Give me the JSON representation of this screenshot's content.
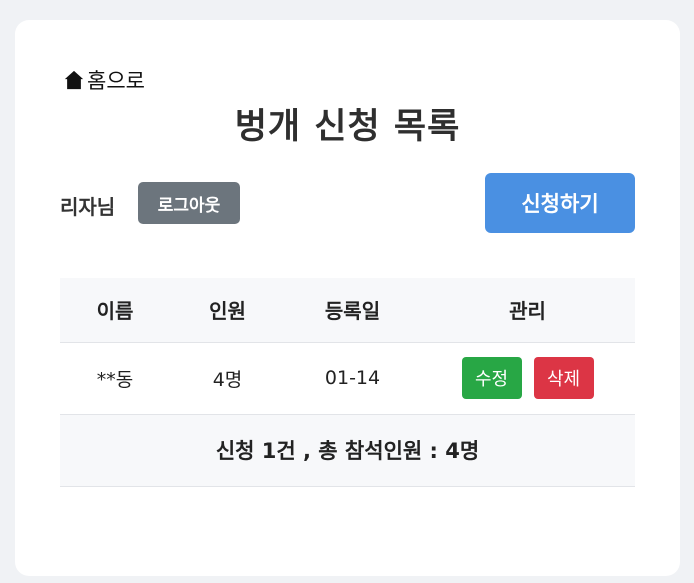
{
  "nav": {
    "home_label": "홈으로",
    "home_icon": "house-icon"
  },
  "page": {
    "title": "벙개 신청 목록"
  },
  "user": {
    "name": "리자님",
    "logout_label": "로그아웃"
  },
  "actions": {
    "apply_label": "신청하기"
  },
  "table": {
    "headers": [
      "이름",
      "인원",
      "등록일",
      "관리"
    ],
    "rows": [
      {
        "name": "**동",
        "count": "4명",
        "date": "01-14",
        "edit_label": "수정",
        "delete_label": "삭제"
      }
    ],
    "summary": "신청 1건 , 총 참석인원 : 4명"
  },
  "colors": {
    "apply": "#4a90e2",
    "logout": "#6c757d",
    "edit": "#28a745",
    "delete": "#dc3545"
  }
}
